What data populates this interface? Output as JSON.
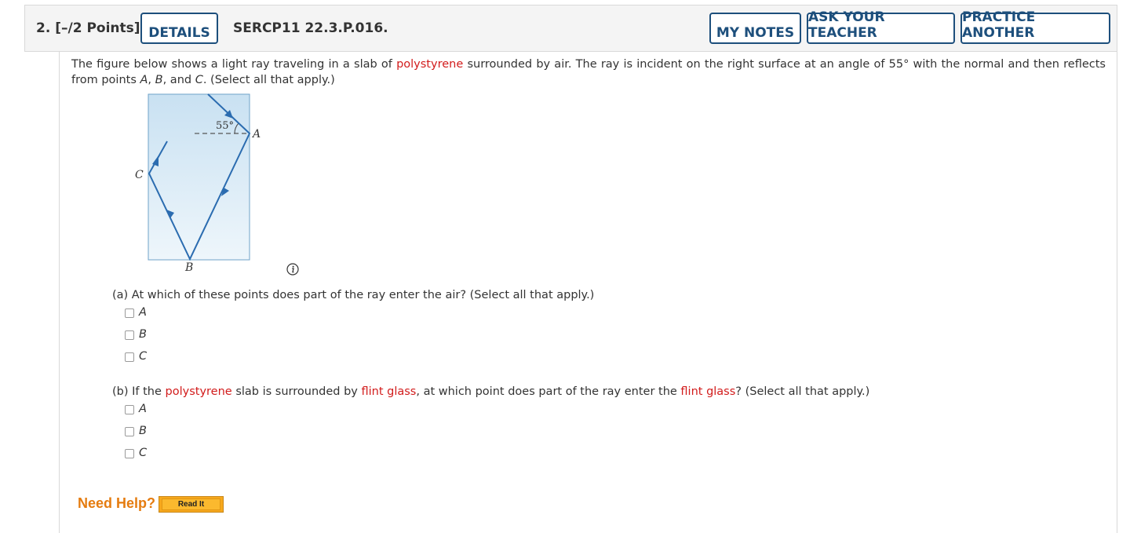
{
  "header": {
    "question_number": "2.",
    "points": "[–/2 Points]",
    "details_label": "DETAILS",
    "problem_code": "SERCP11 22.3.P.016.",
    "my_notes_label": "MY NOTES",
    "ask_teacher_label": "ASK YOUR TEACHER",
    "practice_another_label": "PRACTICE ANOTHER"
  },
  "prompt": {
    "t1": "The figure below shows a light ray traveling in a slab of ",
    "material": "polystyrene",
    "t2": " surrounded by air. The ray is incident on the right surface at an angle of 55° with the normal and then reflects from points ",
    "pA": "A",
    "c1": ", ",
    "pB": "B",
    "c2": ", and ",
    "pC": "C",
    "t3": ". (Select all that apply.)"
  },
  "figure": {
    "angle_label": "55°",
    "point_a": "A",
    "point_b": "B",
    "point_c": "C",
    "line_color": "#2b6cb0",
    "slab_color_top": "#c9e1f2",
    "slab_color_bottom": "#eef6fb"
  },
  "part_a": {
    "t1": "(a) At which of these points does part of the ray enter the air? (Select all that apply.)",
    "options": [
      "A",
      "B",
      "C"
    ]
  },
  "part_b": {
    "t1": "(b) If the ",
    "material": "polystyrene",
    "t2": " slab is surrounded by ",
    "medium1": "flint glass",
    "t3": ", at which point does part of the ray enter the ",
    "medium2": "flint glass",
    "t4": "? (Select all that apply.)",
    "options": [
      "A",
      "B",
      "C"
    ]
  },
  "help": {
    "need_help": "Need Help?",
    "read_it": "Read It"
  },
  "colors": {
    "accent": "#1d4f7c",
    "keyword": "#d21c1c",
    "help": "#e57c10"
  }
}
